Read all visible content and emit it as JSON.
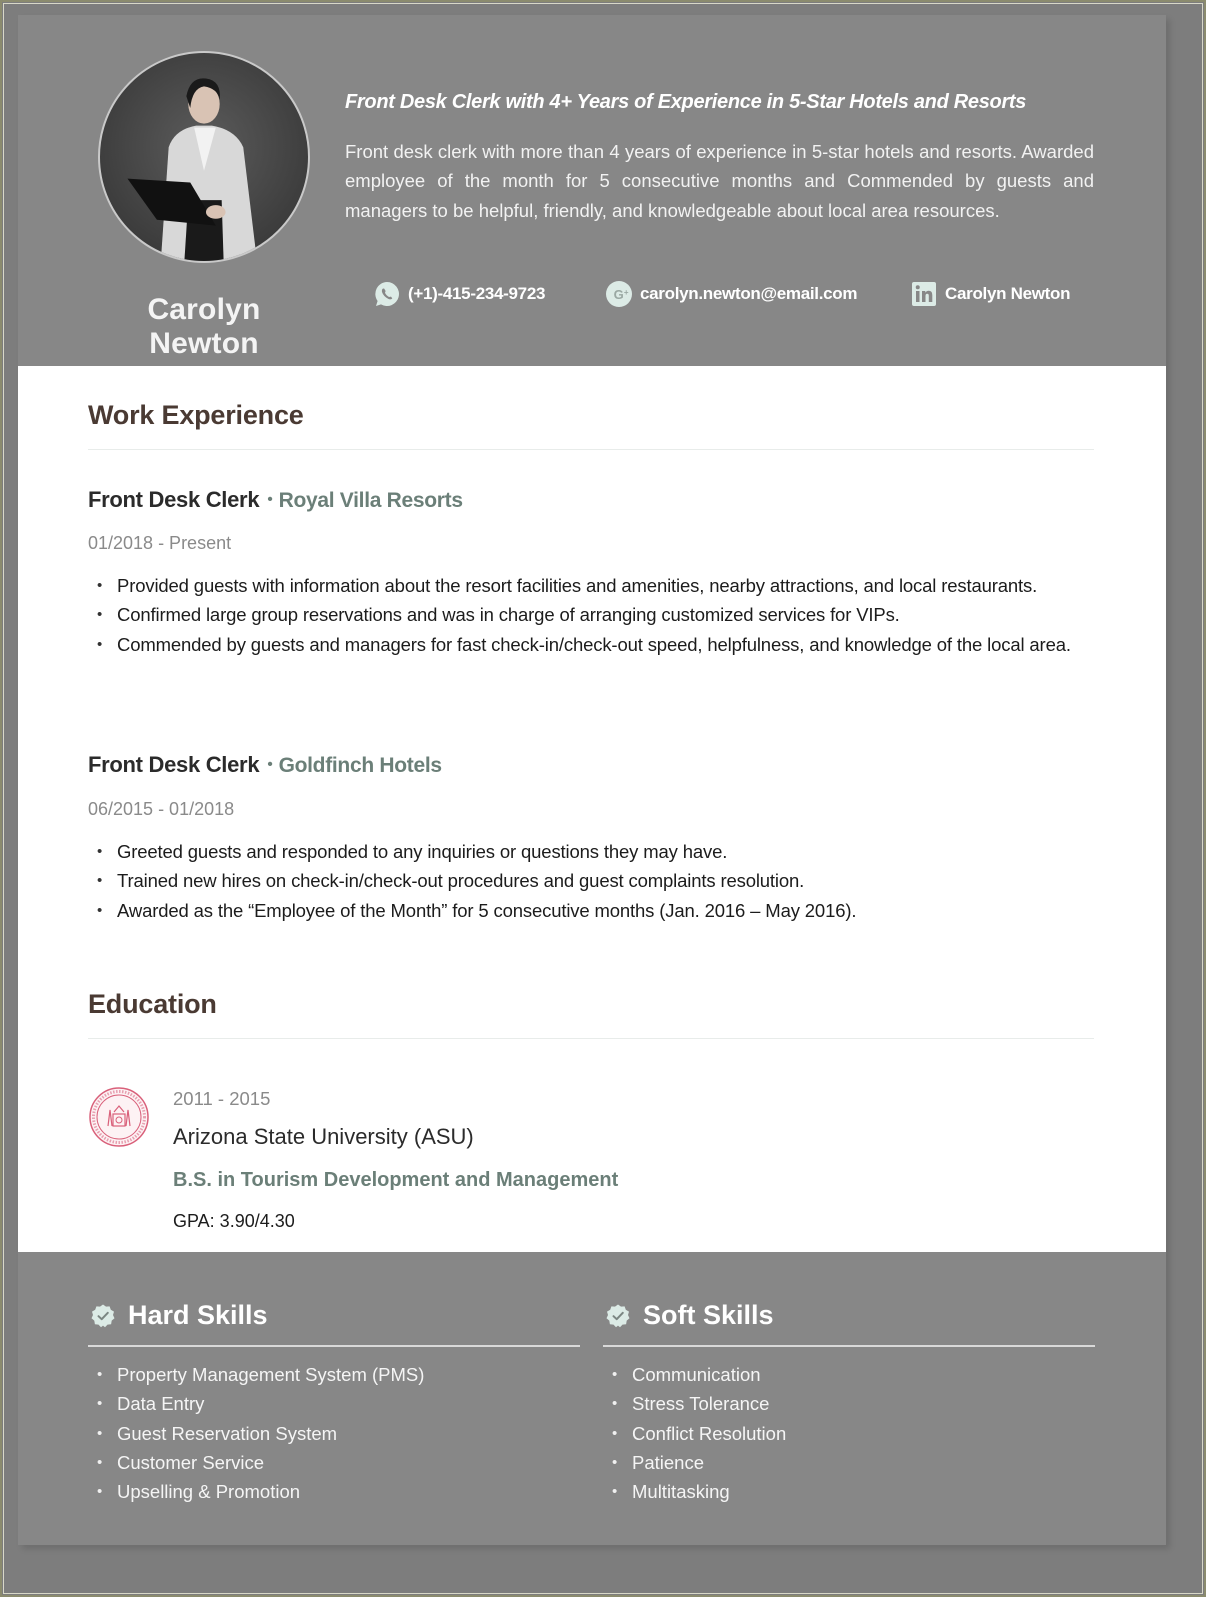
{
  "header": {
    "name": "Carolyn Newton",
    "headline": "Front Desk Clerk with 4+ Years of Experience in 5-Star Hotels and Resorts",
    "summary": "Front desk clerk with more than 4 years of experience in 5-star hotels and resorts. Awarded employee of the month for 5 consecutive months and Commended by guests and managers to be helpful, friendly, and knowledgeable about local area resources.",
    "contacts": [
      {
        "icon": "whatsapp-icon",
        "label": "(+1)-415-234-9723"
      },
      {
        "icon": "google-plus-icon",
        "label": "carolyn.newton@email.com"
      },
      {
        "icon": "linkedin-icon",
        "label": "Carolyn Newton"
      }
    ]
  },
  "work_experience": {
    "title": "Work Experience",
    "jobs": [
      {
        "role": "Front Desk Clerk",
        "separator": "•",
        "company": "Royal Villa Resorts",
        "dates": "01/2018 - Present",
        "bullets": [
          "Provided guests with information about the resort facilities and amenities, nearby attractions, and local restaurants.",
          "Confirmed large group reservations and was in charge of arranging customized services for VIPs.",
          "Commended by guests and managers for fast check-in/check-out speed, helpfulness, and knowledge of the local area."
        ]
      },
      {
        "role": "Front Desk Clerk",
        "separator": "•",
        "company": "Goldfinch Hotels",
        "dates": "06/2015 - 01/2018",
        "bullets": [
          "Greeted guests and responded to any inquiries or questions they may have.",
          "Trained new hires on check-in/check-out procedures and guest complaints resolution.",
          "Awarded as the “Employee of the Month” for 5 consecutive months (Jan. 2016 – May 2016)."
        ]
      }
    ]
  },
  "education": {
    "title": "Education",
    "entries": [
      {
        "logo": "university-seal-icon",
        "years": "2011 - 2015",
        "school": "Arizona State University (ASU)",
        "degree": "B.S. in Tourism Development and Management",
        "gpa": "GPA: 3.90/4.30"
      }
    ]
  },
  "skills": {
    "hard": {
      "title": "Hard Skills",
      "icon": "verified-check-icon",
      "items": [
        "Property Management System (PMS)",
        "Data Entry",
        "Guest Reservation System",
        "Customer Service",
        "Upselling & Promotion"
      ]
    },
    "soft": {
      "title": "Soft Skills",
      "icon": "verified-check-icon",
      "items": [
        "Communication",
        "Stress Tolerance",
        "Conflict Resolution",
        "Patience",
        "Multitasking"
      ]
    }
  },
  "colors": {
    "header_bg": "#878787",
    "accent_green": "#6b7f78",
    "heading_brown": "#4a3a33",
    "icon_mint": "#dcebe6",
    "seal_red": "#d9607a"
  }
}
